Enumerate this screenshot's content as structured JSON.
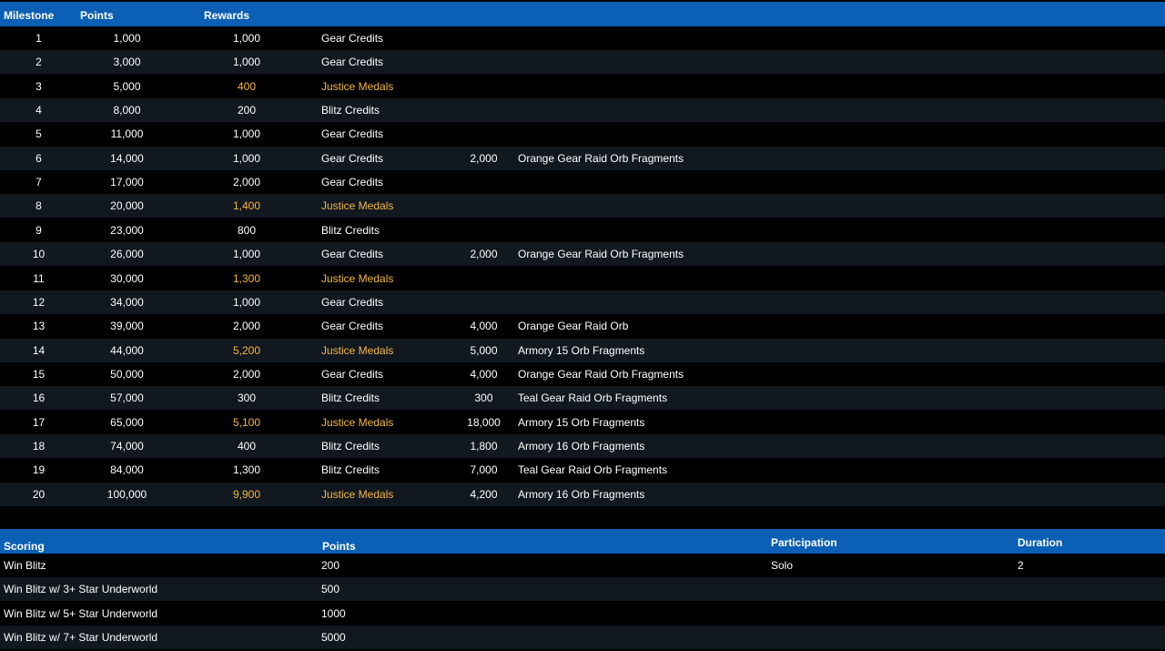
{
  "milestones_table": {
    "headers": {
      "milestone": "Milestone",
      "points": "Points",
      "rewards": "Rewards"
    },
    "highlight_color": "#f4b73e",
    "header_color": "#0b5fb4",
    "rows": [
      {
        "milestone": "1",
        "points": "1,000",
        "reward1_amount": "1,000",
        "reward1_type": "Gear Credits",
        "reward2_amount": "",
        "reward2_type": "",
        "highlight": false
      },
      {
        "milestone": "2",
        "points": "3,000",
        "reward1_amount": "1,000",
        "reward1_type": "Gear Credits",
        "reward2_amount": "",
        "reward2_type": "",
        "highlight": false
      },
      {
        "milestone": "3",
        "points": "5,000",
        "reward1_amount": "400",
        "reward1_type": "Justice Medals",
        "reward2_amount": "",
        "reward2_type": "",
        "highlight": true
      },
      {
        "milestone": "4",
        "points": "8,000",
        "reward1_amount": "200",
        "reward1_type": "Blitz Credits",
        "reward2_amount": "",
        "reward2_type": "",
        "highlight": false
      },
      {
        "milestone": "5",
        "points": "11,000",
        "reward1_amount": "1,000",
        "reward1_type": "Gear Credits",
        "reward2_amount": "",
        "reward2_type": "",
        "highlight": false
      },
      {
        "milestone": "6",
        "points": "14,000",
        "reward1_amount": "1,000",
        "reward1_type": "Gear Credits",
        "reward2_amount": "2,000",
        "reward2_type": "Orange Gear Raid Orb Fragments",
        "highlight": false
      },
      {
        "milestone": "7",
        "points": "17,000",
        "reward1_amount": "2,000",
        "reward1_type": "Gear Credits",
        "reward2_amount": "",
        "reward2_type": "",
        "highlight": false
      },
      {
        "milestone": "8",
        "points": "20,000",
        "reward1_amount": "1,400",
        "reward1_type": "Justice Medals",
        "reward2_amount": "",
        "reward2_type": "",
        "highlight": true
      },
      {
        "milestone": "9",
        "points": "23,000",
        "reward1_amount": "800",
        "reward1_type": "Blitz Credits",
        "reward2_amount": "",
        "reward2_type": "",
        "highlight": false
      },
      {
        "milestone": "10",
        "points": "26,000",
        "reward1_amount": "1,000",
        "reward1_type": "Gear Credits",
        "reward2_amount": "2,000",
        "reward2_type": "Orange Gear Raid Orb Fragments",
        "highlight": false
      },
      {
        "milestone": "11",
        "points": "30,000",
        "reward1_amount": "1,300",
        "reward1_type": "Justice Medals",
        "reward2_amount": "",
        "reward2_type": "",
        "highlight": true
      },
      {
        "milestone": "12",
        "points": "34,000",
        "reward1_amount": "1,000",
        "reward1_type": "Gear Credits",
        "reward2_amount": "",
        "reward2_type": "",
        "highlight": false
      },
      {
        "milestone": "13",
        "points": "39,000",
        "reward1_amount": "2,000",
        "reward1_type": "Gear Credits",
        "reward2_amount": "4,000",
        "reward2_type": "Orange Gear Raid Orb",
        "highlight": false
      },
      {
        "milestone": "14",
        "points": "44,000",
        "reward1_amount": "5,200",
        "reward1_type": "Justice Medals",
        "reward2_amount": "5,000",
        "reward2_type": "Armory 15 Orb Fragments",
        "highlight": true
      },
      {
        "milestone": "15",
        "points": "50,000",
        "reward1_amount": "2,000",
        "reward1_type": "Gear Credits",
        "reward2_amount": "4,000",
        "reward2_type": "Orange Gear Raid Orb Fragments",
        "highlight": false
      },
      {
        "milestone": "16",
        "points": "57,000",
        "reward1_amount": "300",
        "reward1_type": "Blitz Credits",
        "reward2_amount": "300",
        "reward2_type": "Teal Gear Raid Orb Fragments",
        "highlight": false
      },
      {
        "milestone": "17",
        "points": "65,000",
        "reward1_amount": "5,100",
        "reward1_type": "Justice Medals",
        "reward2_amount": "18,000",
        "reward2_type": "Armory 15 Orb Fragments",
        "highlight": true
      },
      {
        "milestone": "18",
        "points": "74,000",
        "reward1_amount": "400",
        "reward1_type": "Blitz Credits",
        "reward2_amount": "1,800",
        "reward2_type": "Armory 16 Orb Fragments",
        "highlight": false
      },
      {
        "milestone": "19",
        "points": "84,000",
        "reward1_amount": "1,300",
        "reward1_type": "Blitz Credits",
        "reward2_amount": "7,000",
        "reward2_type": "Teal Gear Raid Orb Fragments",
        "highlight": false
      },
      {
        "milestone": "20",
        "points": "100,000",
        "reward1_amount": "9,900",
        "reward1_type": "Justice Medals",
        "reward2_amount": "4,200",
        "reward2_type": "Armory 16 Orb Fragments",
        "highlight": true
      }
    ]
  },
  "scoring_table": {
    "headers": {
      "scoring": "Scoring",
      "points": "Points",
      "participation": "Participation",
      "duration": "Duration"
    },
    "rows": [
      {
        "name": "Win Blitz",
        "points": "200",
        "participation": "Solo",
        "duration": "2"
      },
      {
        "name": "Win Blitz w/ 3+ Star Underworld",
        "points": "500",
        "participation": "",
        "duration": ""
      },
      {
        "name": "Win Blitz w/ 5+ Star Underworld",
        "points": "1000",
        "participation": "",
        "duration": ""
      },
      {
        "name": "Win Blitz w/ 7+ Star Underworld",
        "points": "5000",
        "participation": "",
        "duration": ""
      }
    ]
  }
}
